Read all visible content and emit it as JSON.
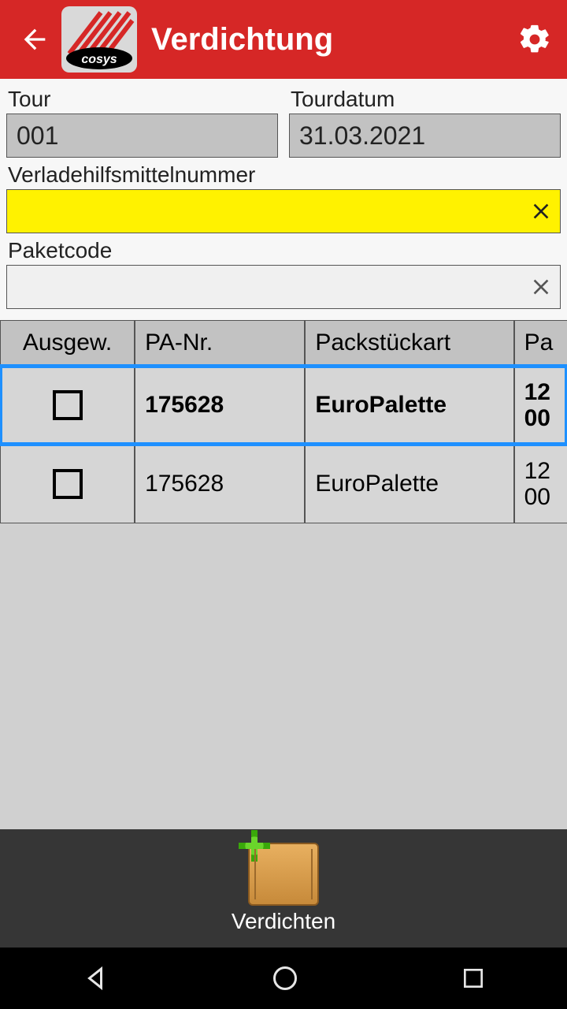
{
  "header": {
    "title": "Verdichtung"
  },
  "form": {
    "tour": {
      "label": "Tour",
      "value": "001"
    },
    "tourdatum": {
      "label": "Tourdatum",
      "value": "31.03.2021"
    },
    "vhm": {
      "label": "Verladehilfsmittelnummer",
      "value": ""
    },
    "paketcode": {
      "label": "Paketcode",
      "value": ""
    }
  },
  "table": {
    "headers": {
      "c1": "Ausgew.",
      "c2": "PA-Nr.",
      "c3": "Packstückart",
      "c4": "Pa"
    },
    "rows": [
      {
        "selected": true,
        "checked": false,
        "pa_nr": "175628",
        "art": "EuroPalette",
        "extra": "12\n00"
      },
      {
        "selected": false,
        "checked": false,
        "pa_nr": "175628",
        "art": "EuroPalette",
        "extra": "12\n00"
      }
    ]
  },
  "action": {
    "label": "Verdichten"
  }
}
